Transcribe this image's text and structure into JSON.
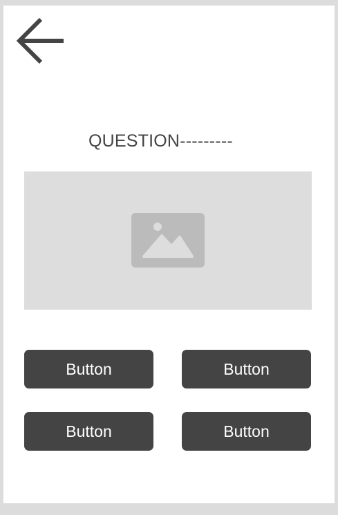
{
  "header": {
    "back_icon": "arrow-left-icon"
  },
  "question": {
    "lines": [
      "QUESTION---------",
      "-------------------------",
      "-------------------------"
    ]
  },
  "image": {
    "icon": "image-icon"
  },
  "buttons": [
    {
      "label": "Button"
    },
    {
      "label": "Button"
    },
    {
      "label": "Button"
    },
    {
      "label": "Button"
    }
  ],
  "colors": {
    "background": "#dcdcdc",
    "screen": "#ffffff",
    "dark": "#444444",
    "placeholder": "#dddddd",
    "icon": "#bbbbbb"
  }
}
